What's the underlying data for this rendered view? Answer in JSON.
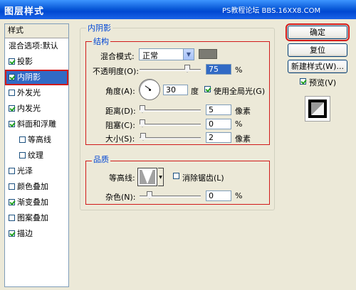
{
  "window": {
    "title": "图层样式",
    "watermark": "PS教程论坛 BBS.16XX8.COM"
  },
  "sidebar": {
    "header": "样式",
    "items": [
      {
        "label": "混合选项:默认",
        "checkbox": false,
        "checked": false,
        "indent": false
      },
      {
        "label": "投影",
        "checkbox": true,
        "checked": true,
        "indent": false
      },
      {
        "label": "内阴影",
        "checkbox": true,
        "checked": true,
        "indent": false,
        "selected": true
      },
      {
        "label": "外发光",
        "checkbox": true,
        "checked": false,
        "indent": false
      },
      {
        "label": "内发光",
        "checkbox": true,
        "checked": true,
        "indent": false
      },
      {
        "label": "斜面和浮雕",
        "checkbox": true,
        "checked": true,
        "indent": false
      },
      {
        "label": "等高线",
        "checkbox": true,
        "checked": false,
        "indent": true
      },
      {
        "label": "纹理",
        "checkbox": true,
        "checked": false,
        "indent": true
      },
      {
        "label": "光泽",
        "checkbox": true,
        "checked": false,
        "indent": false
      },
      {
        "label": "颜色叠加",
        "checkbox": true,
        "checked": false,
        "indent": false
      },
      {
        "label": "渐变叠加",
        "checkbox": true,
        "checked": true,
        "indent": false
      },
      {
        "label": "图案叠加",
        "checkbox": true,
        "checked": false,
        "indent": false
      },
      {
        "label": "描边",
        "checkbox": true,
        "checked": true,
        "indent": false
      }
    ]
  },
  "panel": {
    "title": "内阴影",
    "structure": {
      "title": "结构",
      "blend_mode_label": "混合模式:",
      "blend_mode_value": "正常",
      "opacity_label": "不透明度(O):",
      "opacity_value": "75",
      "opacity_unit": "%",
      "angle_label": "角度(A):",
      "angle_value": "30",
      "angle_unit": "度",
      "global_light_label": "使用全局光(G)",
      "distance_label": "距离(D):",
      "distance_value": "5",
      "distance_unit": "像素",
      "choke_label": "阻塞(C):",
      "choke_value": "0",
      "choke_unit": "%",
      "size_label": "大小(S):",
      "size_value": "2",
      "size_unit": "像素"
    },
    "quality": {
      "title": "品质",
      "contour_label": "等高线:",
      "antialias_label": "消除锯齿(L)",
      "noise_label": "杂色(N):",
      "noise_value": "0",
      "noise_unit": "%"
    }
  },
  "buttons": {
    "ok": "确定",
    "reset": "复位",
    "new_style": "新建样式(W)...",
    "preview_label": "预览(V)"
  },
  "colors": {
    "shadow_color": "#7b7b73",
    "title_bar": "#0a5ad8",
    "selection": "#316ac5",
    "highlight_box": "#d11a1a"
  }
}
